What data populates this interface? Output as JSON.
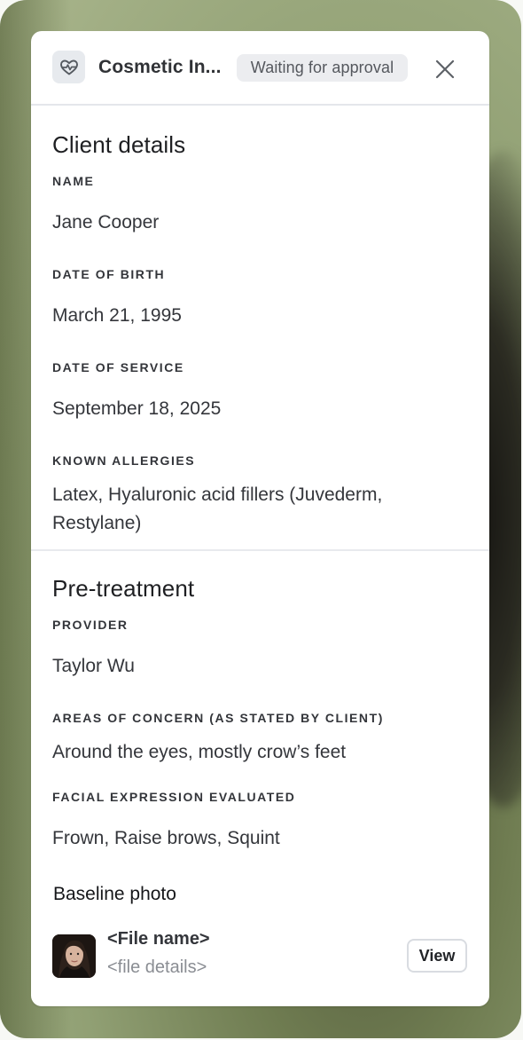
{
  "header": {
    "title": "Cosmetic In...",
    "status": "Waiting for approval",
    "icon": "heart-pulse-icon",
    "close_icon": "close-icon"
  },
  "client_details": {
    "title": "Client details",
    "fields": [
      {
        "label": "NAME",
        "value": "Jane Cooper"
      },
      {
        "label": "DATE OF BIRTH",
        "value": "March 21, 1995"
      },
      {
        "label": "DATE OF SERVICE",
        "value": "September 18, 2025"
      },
      {
        "label": "KNOWN ALLERGIES",
        "value": "Latex, Hyaluronic acid fillers (Juvederm, Restylane)"
      }
    ]
  },
  "pre_treatment": {
    "title": "Pre-treatment",
    "fields": [
      {
        "label": "PROVIDER",
        "value": "Taylor Wu"
      },
      {
        "label": "AREAS OF CONCERN (AS STATED BY CLIENT)",
        "value": "Around the eyes, mostly crow’s feet"
      },
      {
        "label": "FACIAL EXPRESSION EVALUATED",
        "value": "Frown, Raise brows, Squint"
      }
    ]
  },
  "baseline_photo": {
    "title": "Baseline photo",
    "file_name": "<File name>",
    "file_details": "<file details>",
    "view_label": "View"
  },
  "colors": {
    "panel_background": "#ffffff",
    "badge_background": "#ecedf0",
    "primary_text": "#1e1f22",
    "secondary_text": "#8a8d93"
  }
}
